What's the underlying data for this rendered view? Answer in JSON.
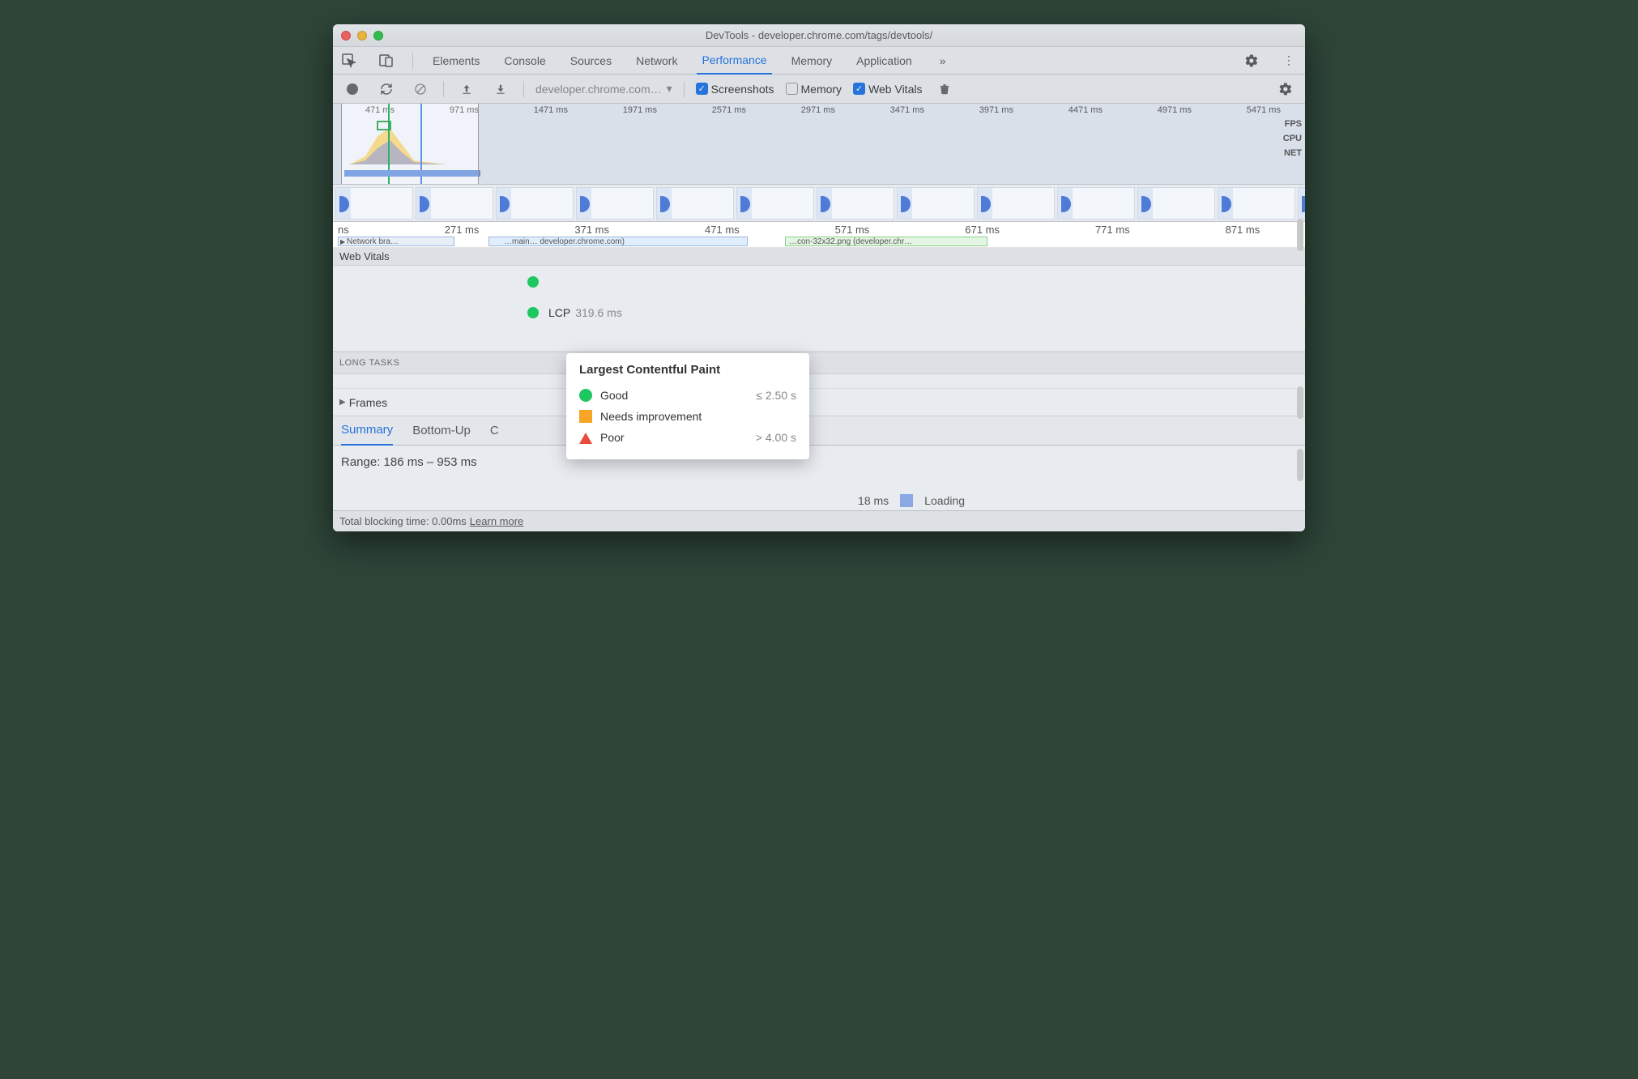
{
  "window": {
    "title": "DevTools - developer.chrome.com/tags/devtools/"
  },
  "tabs": {
    "elements": "Elements",
    "console": "Console",
    "sources": "Sources",
    "network": "Network",
    "performance": "Performance",
    "memory": "Memory",
    "application": "Application"
  },
  "toolbar": {
    "dropdown": "developer.chrome.com…",
    "screenshots": "Screenshots",
    "memory": "Memory",
    "webvitals": "Web Vitals"
  },
  "overview": {
    "ticks": [
      "471 ms",
      "971 ms",
      "1471 ms",
      "1971 ms",
      "2571 ms",
      "2971 ms",
      "3471 ms",
      "3971 ms",
      "4471 ms",
      "4971 ms",
      "5471 ms"
    ],
    "rows": {
      "fps": "FPS",
      "cpu": "CPU",
      "net": "NET"
    }
  },
  "flame": {
    "ticks": [
      "ns",
      "271 ms",
      "371 ms",
      "471 ms",
      "571 ms",
      "671 ms",
      "771 ms",
      "871 ms"
    ],
    "a": "Network bra…",
    "b": "…main… developer.chrome.com)",
    "c": "…con-32x32.png (developer.chr…"
  },
  "webvitals": {
    "title": "Web Vitals",
    "lcp_label": "LCP",
    "lcp_value": "319.6 ms"
  },
  "longtasks": "LONG TASKS",
  "frames": "Frames",
  "bottom_tabs": {
    "summary": "Summary",
    "bottomup": "Bottom-Up",
    "call": "C"
  },
  "range": {
    "text": "Range: 186 ms – 953 ms",
    "loading_ms": "18 ms",
    "loading_label": "Loading"
  },
  "footer": {
    "text": "Total blocking time: 0.00ms",
    "link": "Learn more"
  },
  "tooltip": {
    "title": "Largest Contentful Paint",
    "good": "Good",
    "good_val": "≤ 2.50 s",
    "needs": "Needs improvement",
    "poor": "Poor",
    "poor_val": "> 4.00 s"
  }
}
